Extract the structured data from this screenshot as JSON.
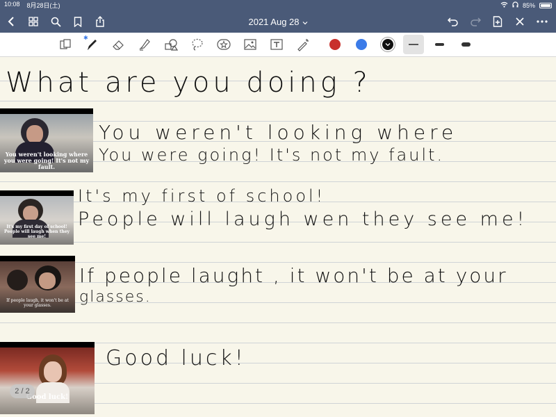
{
  "status_bar": {
    "time": "10:08",
    "date": "8月28日(土)",
    "battery": "85%"
  },
  "nav": {
    "title": "2021 Aug 28",
    "title_chevron": "⌄"
  },
  "toolbar": {
    "colors": {
      "red": "#c8302c",
      "blue": "#3b7be8",
      "black": "#111111"
    }
  },
  "note": {
    "heading": "What  are  you  doing  ?",
    "entries": [
      {
        "caption": "You weren't looking where you were going! It's not my fault.",
        "line1": "You  weren't  looking  where",
        "line2": "You  were  going!  It's  not  my  fault."
      },
      {
        "caption": "It's my first day of school! People will laugh when they see me!",
        "line1": "It's  my  first  of  school!",
        "line2": "People  will  laugh  wen  they  see  me!"
      },
      {
        "caption": "If people laugh, it won't be at your glasses.",
        "line1": "If  people  laught ,  it  won't  be  at  your",
        "line2": "glasses."
      },
      {
        "caption": "Good luck!",
        "line1": "Good  luck!"
      }
    ]
  },
  "page_indicator": "2 / 2"
}
